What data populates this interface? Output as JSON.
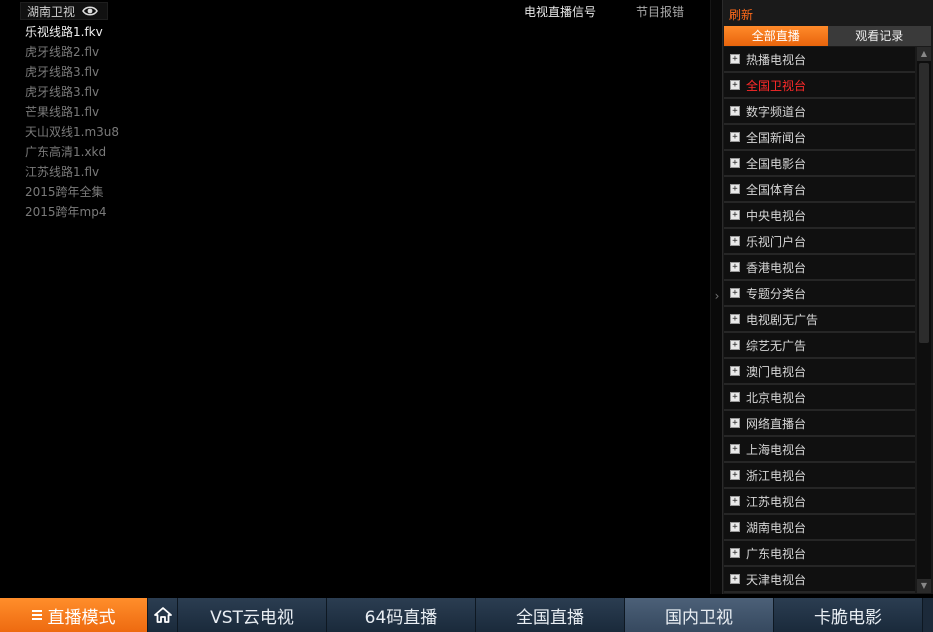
{
  "channel": {
    "title": "湖南卫视",
    "eye_icon": "eye-icon"
  },
  "sources": [
    {
      "label": "乐视线路1.fkv",
      "active": true
    },
    {
      "label": "虎牙线路2.flv",
      "active": false
    },
    {
      "label": "虎牙线路3.flv",
      "active": false
    },
    {
      "label": "虎牙线路3.flv",
      "active": false
    },
    {
      "label": "芒果线路1.flv",
      "active": false
    },
    {
      "label": "天山双线1.m3u8",
      "active": false
    },
    {
      "label": "广东高清1.xkd",
      "active": false
    },
    {
      "label": "江苏线路1.flv",
      "active": false
    },
    {
      "label": "2015跨年全集",
      "active": false
    },
    {
      "label": "2015跨年mp4",
      "active": false
    }
  ],
  "top_links": {
    "tv_signal": "电视直播信号",
    "report_error": "节目报错"
  },
  "panel": {
    "refresh": "刷新",
    "tabs": [
      {
        "label": "全部直播",
        "active": true
      },
      {
        "label": "观看记录",
        "active": false
      }
    ],
    "categories": [
      {
        "label": "热播电视台",
        "selected": false
      },
      {
        "label": "全国卫视台",
        "selected": true
      },
      {
        "label": "数字频道台",
        "selected": false
      },
      {
        "label": "全国新闻台",
        "selected": false
      },
      {
        "label": "全国电影台",
        "selected": false
      },
      {
        "label": "全国体育台",
        "selected": false
      },
      {
        "label": "中央电视台",
        "selected": false
      },
      {
        "label": "乐视门户台",
        "selected": false
      },
      {
        "label": "香港电视台",
        "selected": false
      },
      {
        "label": "专题分类台",
        "selected": false
      },
      {
        "label": "电视剧无广告",
        "selected": false
      },
      {
        "label": "综艺无广告",
        "selected": false
      },
      {
        "label": "澳门电视台",
        "selected": false
      },
      {
        "label": "北京电视台",
        "selected": false
      },
      {
        "label": "网络直播台",
        "selected": false
      },
      {
        "label": "上海电视台",
        "selected": false
      },
      {
        "label": "浙江电视台",
        "selected": false
      },
      {
        "label": "江苏电视台",
        "selected": false
      },
      {
        "label": "湖南电视台",
        "selected": false
      },
      {
        "label": "广东电视台",
        "selected": false
      },
      {
        "label": "天津电视台",
        "selected": false
      }
    ]
  },
  "bottom_nav": {
    "mode": "直播模式",
    "items": [
      {
        "label": "VST云电视",
        "highlight": false
      },
      {
        "label": "64码直播",
        "highlight": false
      },
      {
        "label": "全国直播",
        "highlight": false
      },
      {
        "label": "国内卫视",
        "highlight": true
      },
      {
        "label": "卡脆电影",
        "highlight": false
      }
    ]
  },
  "colors": {
    "accent_orange": "#ff8a2a",
    "selected_red": "#ff2a2a",
    "nav_bg": "#1c2a3a"
  }
}
